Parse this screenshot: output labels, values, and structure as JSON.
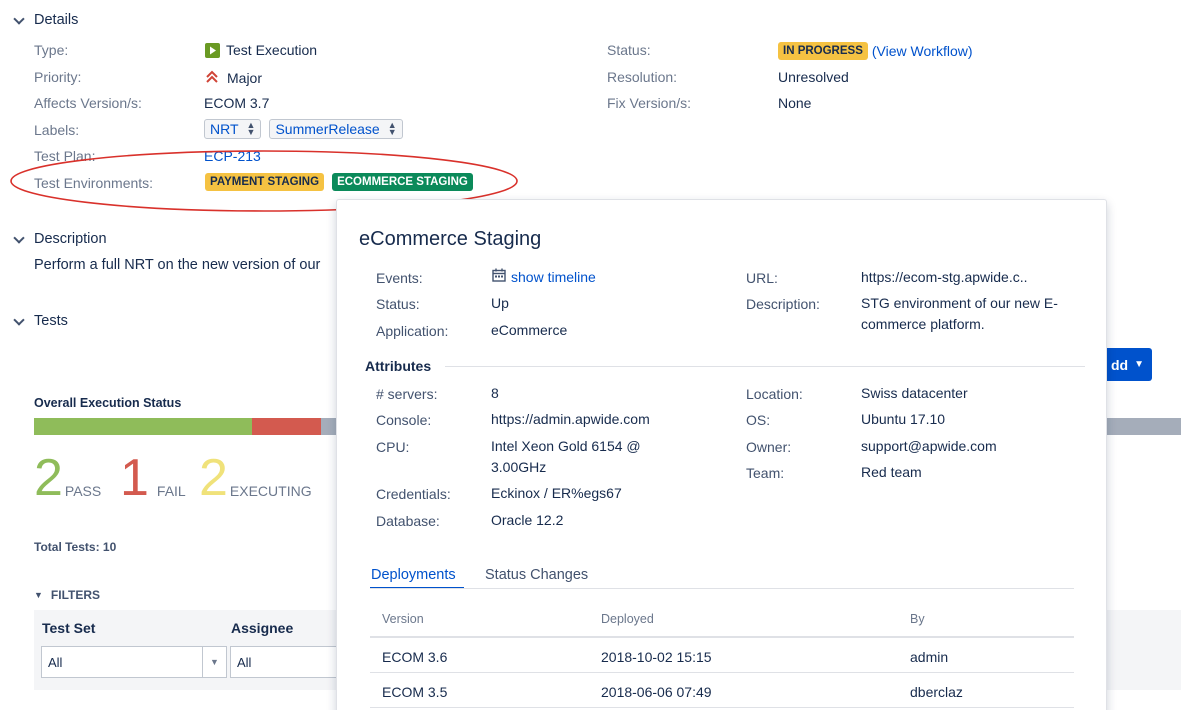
{
  "details": {
    "heading": "Details",
    "type_label": "Type:",
    "type_value": "Test Execution",
    "priority_label": "Priority:",
    "priority_value": "Major",
    "affects_label": "Affects Version/s:",
    "affects_value": "ECOM 3.7",
    "labels_label": "Labels:",
    "labels": [
      "NRT",
      "SummerRelease"
    ],
    "testplan_label": "Test Plan:",
    "testplan_value": "ECP-213",
    "testenv_label": "Test Environments:",
    "testenvs": [
      "PAYMENT STAGING",
      "ECOMMERCE STAGING"
    ],
    "status_label": "Status:",
    "status_value": "IN PROGRESS",
    "view_workflow": "(View Workflow)",
    "resolution_label": "Resolution:",
    "resolution_value": "Unresolved",
    "fix_label": "Fix Version/s:",
    "fix_value": "None"
  },
  "description": {
    "heading": "Description",
    "text": "Perform a full NRT on the new version of our"
  },
  "tests": {
    "heading": "Tests",
    "add_button": "dd",
    "overall_label": "Overall Execution Status",
    "progress": {
      "pass_fraction": 0.19,
      "fail_fraction": 0.06
    },
    "pass_count": "2",
    "pass_label": "PASS",
    "fail_count": "1",
    "fail_label": "FAIL",
    "exec_count": "2",
    "exec_label": "EXECUTING",
    "total_label": "Total Tests: 10",
    "filters_label": "FILTERS",
    "filter_cols": [
      "Test Set",
      "Assignee"
    ],
    "filter_values": [
      "All",
      "All"
    ]
  },
  "popup": {
    "title": "eCommerce Staging",
    "events_label": "Events:",
    "events_value": "show timeline",
    "status_label": "Status:",
    "status_value": "Up",
    "application_label": "Application:",
    "application_value": "eCommerce",
    "url_label": "URL:",
    "url_value": "https://ecom-stg.apwide.c..",
    "desc_label": "Description:",
    "desc_value": "STG environment of our new E-commerce platform.",
    "attributes_heading": "Attributes",
    "servers_label": "# servers:",
    "servers_value": "8",
    "console_label": "Console:",
    "console_value": "https://admin.apwide.com",
    "cpu_label": "CPU:",
    "cpu_value": "Intel Xeon Gold 6154 @ 3.00GHz",
    "credentials_label": "Credentials:",
    "credentials_value": "Eckinox / ER%egs67",
    "database_label": "Database:",
    "database_value": "Oracle 12.2",
    "location_label": "Location:",
    "location_value": "Swiss datacenter",
    "os_label": "OS:",
    "os_value": "Ubuntu 17.10",
    "owner_label": "Owner:",
    "owner_value": "support@apwide.com",
    "team_label": "Team:",
    "team_value": "Red team",
    "tabs": [
      "Deployments",
      "Status Changes"
    ],
    "table_headers": [
      "Version",
      "Deployed",
      "By"
    ],
    "rows": [
      {
        "version": "ECOM 3.6",
        "deployed": "2018-10-02 15:15",
        "by": "admin"
      },
      {
        "version": "ECOM 3.5",
        "deployed": "2018-06-06 07:49",
        "by": "dberclaz"
      }
    ]
  },
  "colors": {
    "pass": "#8fbc5a",
    "fail": "#d35a4f",
    "executing": "#f0e27a",
    "link": "#0052cc",
    "annotation": "#d9312b"
  }
}
